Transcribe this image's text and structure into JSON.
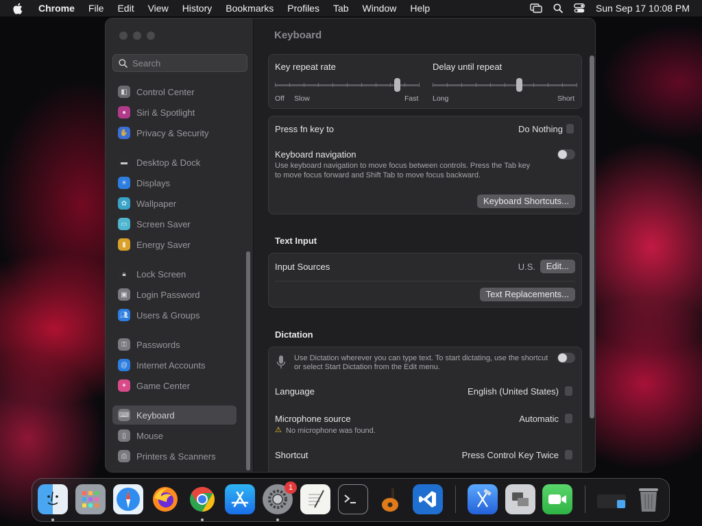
{
  "menubar": {
    "app_name": "Chrome",
    "menus": [
      "File",
      "Edit",
      "View",
      "History",
      "Bookmarks",
      "Profiles",
      "Tab",
      "Window",
      "Help"
    ],
    "datetime": "Sun Sep 17  10:08 PM"
  },
  "sidebar": {
    "search_placeholder": "Search",
    "items": [
      {
        "label": "Control Center",
        "color": "#6b6b70"
      },
      {
        "label": "Siri & Spotlight",
        "color": "#b23a8a"
      },
      {
        "label": "Privacy & Security",
        "color": "#3a6fd8"
      },
      {
        "label": "Desktop & Dock",
        "color": "#2c2c2e"
      },
      {
        "label": "Displays",
        "color": "#2d7ee0"
      },
      {
        "label": "Wallpaper",
        "color": "#3aa4c8"
      },
      {
        "label": "Screen Saver",
        "color": "#4fb5d0"
      },
      {
        "label": "Energy Saver",
        "color": "#d9a12a"
      },
      {
        "label": "Lock Screen",
        "color": "#2c2c2e"
      },
      {
        "label": "Login Password",
        "color": "#7a7a80"
      },
      {
        "label": "Users & Groups",
        "color": "#2d7ee0"
      },
      {
        "label": "Passwords",
        "color": "#7a7a80"
      },
      {
        "label": "Internet Accounts",
        "color": "#2d7ee0"
      },
      {
        "label": "Game Center",
        "color": "#d94a8a"
      },
      {
        "label": "Keyboard",
        "color": "#7a7a80"
      },
      {
        "label": "Mouse",
        "color": "#7a7a80"
      },
      {
        "label": "Printers & Scanners",
        "color": "#7a7a80"
      }
    ]
  },
  "main": {
    "title": "Keyboard",
    "key_repeat": {
      "label": "Key repeat rate",
      "min_label": "Off",
      "slow_label": "Slow",
      "max_label": "Fast",
      "value": 0.85
    },
    "delay_repeat": {
      "label": "Delay until repeat",
      "min_label": "Long",
      "max_label": "Short",
      "value": 0.6
    },
    "fn_key": {
      "label": "Press fn key to",
      "value": "Do Nothing"
    },
    "keyboard_nav": {
      "label": "Keyboard navigation",
      "description_line1": "Use keyboard navigation to move focus between controls. Press the Tab key",
      "description_line2": "to move focus forward and Shift Tab to move focus backward.",
      "enabled": false
    },
    "shortcuts_button": "Keyboard Shortcuts...",
    "text_input": {
      "title": "Text Input",
      "input_sources_label": "Input Sources",
      "input_sources_value": "U.S.",
      "edit_button": "Edit...",
      "replacements_button": "Text Replacements..."
    },
    "dictation": {
      "title": "Dictation",
      "description_line1": "Use Dictation wherever you can type text. To start dictating, use the shortcut",
      "description_line2": "or select Start Dictation from the Edit menu.",
      "enabled": false,
      "language_label": "Language",
      "language_value": "English (United States)",
      "mic_label": "Microphone source",
      "mic_value": "Automatic",
      "mic_warning": "No microphone was found.",
      "shortcut_label": "Shortcut",
      "shortcut_value": "Press Control Key Twice"
    }
  },
  "dock": {
    "settings_badge": "1"
  }
}
